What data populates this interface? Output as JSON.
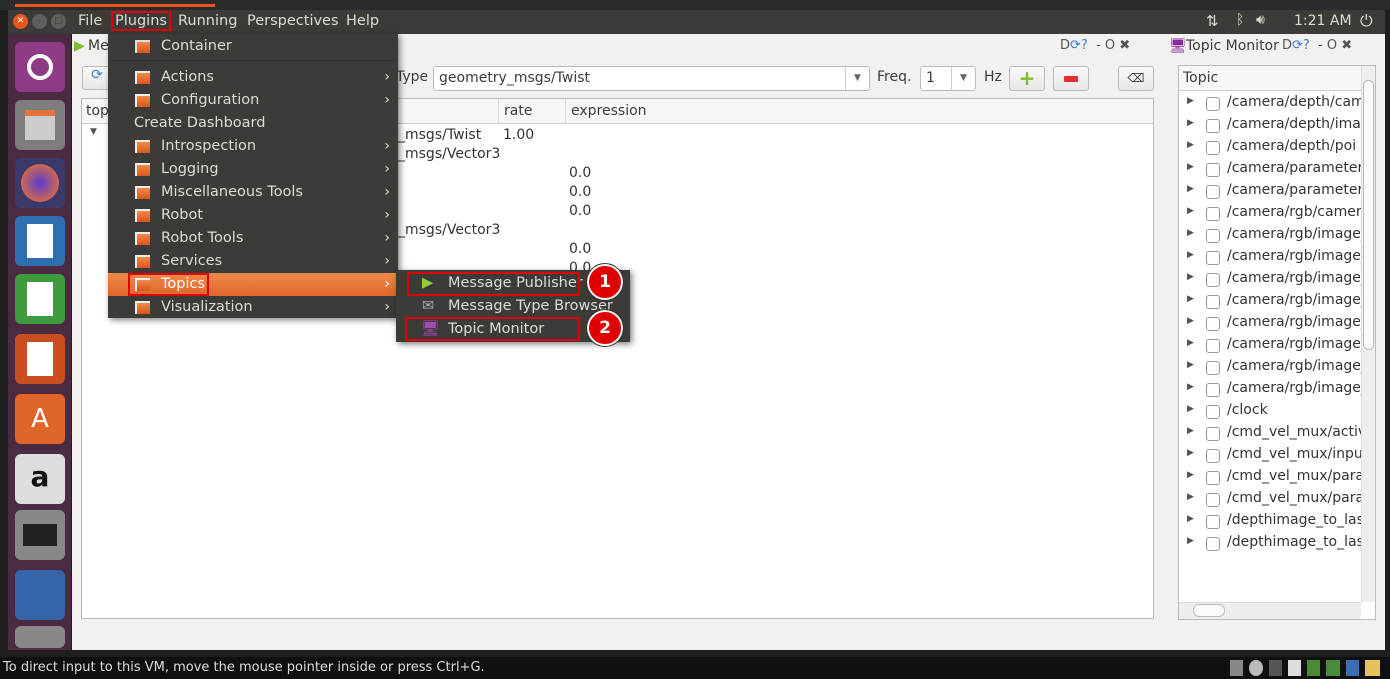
{
  "menubar": {
    "items": [
      "File",
      "Plugins",
      "Running",
      "Perspectives",
      "Help"
    ],
    "clock": "1:21 AM"
  },
  "plugins_menu": {
    "items": [
      {
        "label": "Container",
        "submenu": false
      },
      {
        "label": "Actions",
        "submenu": true
      },
      {
        "label": "Configuration",
        "submenu": true
      },
      {
        "label": "Create Dashboard",
        "submenu": false
      },
      {
        "label": "Introspection",
        "submenu": true
      },
      {
        "label": "Logging",
        "submenu": true
      },
      {
        "label": "Miscellaneous Tools",
        "submenu": true
      },
      {
        "label": "Robot",
        "submenu": true
      },
      {
        "label": "Robot Tools",
        "submenu": true
      },
      {
        "label": "Services",
        "submenu": true
      },
      {
        "label": "Topics",
        "submenu": true,
        "highlighted": true
      },
      {
        "label": "Visualization",
        "submenu": true
      }
    ]
  },
  "topics_submenu": {
    "items": [
      "Message Publisher",
      "Message Type Browser",
      "Topic Monitor"
    ],
    "badges": [
      "1",
      "2"
    ]
  },
  "publisher": {
    "title": "Me",
    "type_label": "Type",
    "type_value": "geometry_msgs/Twist",
    "freq_label": "Freq.",
    "freq_value": "1",
    "hz_label": "Hz",
    "columns": [
      "top",
      "rate",
      "expression"
    ],
    "rows": [
      {
        "type": "_msgs/Twist",
        "rate": "1.00",
        "expr": ""
      },
      {
        "type": "_msgs/Vector3",
        "rate": "",
        "expr": ""
      },
      {
        "type": "",
        "rate": "",
        "expr": "0.0"
      },
      {
        "type": "",
        "rate": "",
        "expr": "0.0"
      },
      {
        "type": "",
        "rate": "",
        "expr": "0.0"
      },
      {
        "type": "_msgs/Vector3",
        "rate": "",
        "expr": ""
      },
      {
        "type": "",
        "rate": "",
        "expr": "0.0"
      },
      {
        "type": "",
        "rate": "",
        "expr": "0.0"
      }
    ]
  },
  "topic_monitor": {
    "title": "Topic Monitor",
    "column": "Topic",
    "topics": [
      "/camera/depth/cam",
      "/camera/depth/ima",
      "/camera/depth/poi",
      "/camera/parameter",
      "/camera/parameter",
      "/camera/rgb/camera",
      "/camera/rgb/image_",
      "/camera/rgb/image_",
      "/camera/rgb/image_",
      "/camera/rgb/image_",
      "/camera/rgb/image_",
      "/camera/rgb/image_",
      "/camera/rgb/image_",
      "/camera/rgb/image_",
      "/clock",
      "/cmd_vel_mux/activ",
      "/cmd_vel_mux/inpu",
      "/cmd_vel_mux/para",
      "/cmd_vel_mux/para",
      "/depthimage_to_las",
      "/depthimage_to_las"
    ]
  },
  "dock": {
    "letters": "D"
  },
  "statusbar": {
    "text": "To direct input to this VM, move the mouse pointer inside or press Ctrl+G."
  }
}
